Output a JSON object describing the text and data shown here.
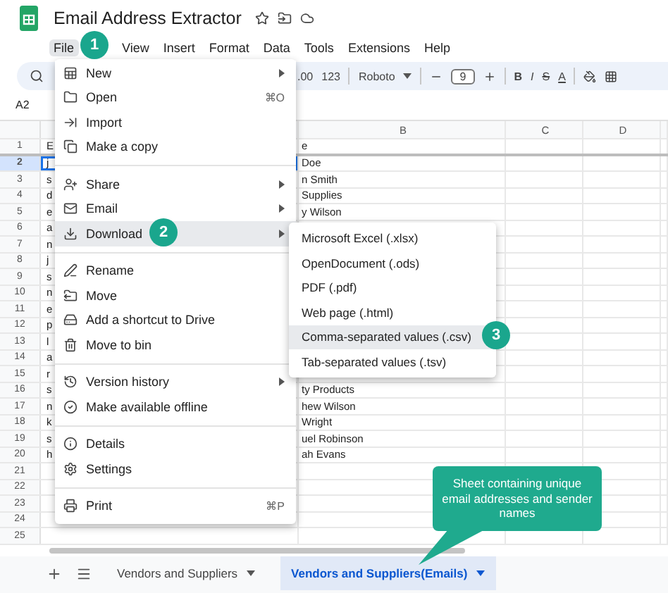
{
  "document": {
    "title": "Email Address Extractor"
  },
  "menus": [
    {
      "label": "File",
      "selected": true
    },
    {
      "label": "View",
      "selected": false
    },
    {
      "label": "Insert",
      "selected": false
    },
    {
      "label": "Format",
      "selected": false
    },
    {
      "label": "Data",
      "selected": false
    },
    {
      "label": "Tools",
      "selected": false
    },
    {
      "label": "Extensions",
      "selected": false
    },
    {
      "label": "Help",
      "selected": false
    }
  ],
  "toolbar": {
    "items": [
      {
        "kind": "format",
        "label": ".00"
      },
      {
        "kind": "format",
        "label": "123"
      },
      {
        "kind": "font",
        "label": "Roboto"
      },
      {
        "kind": "size",
        "label": "9"
      },
      {
        "kind": "bold",
        "label": "B"
      },
      {
        "kind": "italic",
        "label": "I"
      },
      {
        "kind": "strike",
        "label": "S"
      },
      {
        "kind": "color",
        "label": "A"
      }
    ]
  },
  "name_box": "A2",
  "columns": [
    "B",
    "C",
    "D"
  ],
  "rows": [
    {
      "number": "1",
      "column_a": "E",
      "column_b": "e",
      "selected": false
    },
    {
      "number": "2",
      "column_a": "j",
      "column_b": "Doe",
      "selected": true
    },
    {
      "number": "3",
      "column_a": "s",
      "column_b": "n Smith",
      "selected": false
    },
    {
      "number": "4",
      "column_a": "d",
      "column_b": "Supplies",
      "selected": false
    },
    {
      "number": "5",
      "column_a": "e",
      "column_b": "y Wilson",
      "selected": false
    },
    {
      "number": "6",
      "column_a": "a",
      "selected": false
    },
    {
      "number": "7",
      "column_a": "n",
      "selected": false
    },
    {
      "number": "8",
      "column_a": "j",
      "selected": false
    },
    {
      "number": "9",
      "column_a": "s",
      "selected": false
    },
    {
      "number": "10",
      "column_a": "n",
      "selected": false
    },
    {
      "number": "11",
      "column_a": "e",
      "selected": false
    },
    {
      "number": "12",
      "column_a": "p",
      "selected": false
    },
    {
      "number": "13",
      "column_a": "l",
      "selected": false
    },
    {
      "number": "14",
      "column_a": "a",
      "selected": false
    },
    {
      "number": "15",
      "column_a": "r",
      "selected": false
    },
    {
      "number": "16",
      "column_a": "s",
      "column_b": "ty Products",
      "selected": false
    },
    {
      "number": "17",
      "column_a": "n",
      "column_b": "hew Wilson",
      "selected": false
    },
    {
      "number": "18",
      "column_a": "k",
      "column_b": "Wright",
      "selected": false
    },
    {
      "number": "19",
      "column_a": "s",
      "column_b": "uel Robinson",
      "selected": false
    },
    {
      "number": "20",
      "column_a": "h",
      "column_b": "ah Evans",
      "selected": false
    },
    {
      "number": "21",
      "selected": false
    },
    {
      "number": "22",
      "selected": false
    },
    {
      "number": "23",
      "selected": false
    },
    {
      "number": "24",
      "selected": false
    },
    {
      "number": "25",
      "selected": false
    }
  ],
  "file_menu": {
    "sections": [
      [
        {
          "label": "New",
          "submenu": true,
          "selected": false
        },
        {
          "label": "Open",
          "shortcut": "⌘O",
          "submenu": false,
          "selected": false
        },
        {
          "label": "Import",
          "submenu": false,
          "selected": false
        },
        {
          "label": "Make a copy",
          "submenu": false,
          "selected": false
        }
      ],
      [
        {
          "label": "Share",
          "submenu": true,
          "selected": false
        },
        {
          "label": "Email",
          "submenu": true,
          "selected": false
        },
        {
          "label": "Download",
          "submenu": true,
          "selected": true
        }
      ],
      [
        {
          "label": "Rename",
          "submenu": false,
          "selected": false
        },
        {
          "label": "Move",
          "submenu": false,
          "selected": false
        },
        {
          "label": "Add a shortcut to Drive",
          "submenu": false,
          "selected": false
        },
        {
          "label": "Move to bin",
          "submenu": false,
          "selected": false
        }
      ],
      [
        {
          "label": "Version history",
          "submenu": true,
          "selected": false
        },
        {
          "label": "Make available offline",
          "submenu": false,
          "selected": false
        }
      ],
      [
        {
          "label": "Details",
          "submenu": false,
          "selected": false
        },
        {
          "label": "Settings",
          "submenu": false,
          "selected": false
        }
      ],
      [
        {
          "label": "Print",
          "shortcut": "⌘P",
          "submenu": false,
          "selected": false
        }
      ]
    ]
  },
  "download_menu": [
    {
      "label": "Microsoft Excel (.xlsx)",
      "selected": false
    },
    {
      "label": "OpenDocument (.ods)",
      "selected": false
    },
    {
      "label": "PDF (.pdf)",
      "selected": false
    },
    {
      "label": "Web page (.html)",
      "selected": false
    },
    {
      "label": "Comma-separated values (.csv)",
      "selected": true
    },
    {
      "label": "Tab-separated values (.tsv)",
      "selected": false
    }
  ],
  "step_markers": [
    "1",
    "2",
    "3"
  ],
  "sheet_tabs": [
    {
      "label": "Vendors and Suppliers",
      "selected": false
    },
    {
      "label": "Vendors and Suppliers(Emails)",
      "selected": true
    }
  ],
  "callout": "Sheet containing unique email addresses and sender names"
}
